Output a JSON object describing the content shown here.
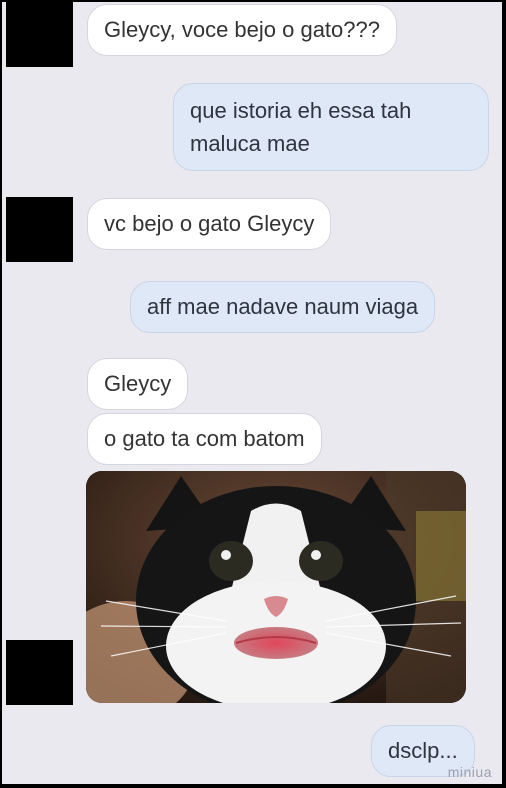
{
  "conversation": {
    "messages": [
      {
        "side": "received",
        "text": "Gleycy, voce bejo o gato???"
      },
      {
        "side": "sent",
        "text": "que istoria eh essa tah maluca mae"
      },
      {
        "side": "received",
        "text": "vc bejo o gato Gleycy"
      },
      {
        "side": "sent",
        "text": "aff mae nadave naum viaga"
      },
      {
        "side": "received",
        "text": "Gleycy"
      },
      {
        "side": "received",
        "text": "o gato ta com batom"
      },
      {
        "side": "sent",
        "text": "dsclp..."
      }
    ],
    "photo": {
      "icon": "cat-with-lipstick-photo"
    }
  },
  "watermark": "miniua",
  "colors": {
    "received_bubble": "#ffffff",
    "sent_bubble": "#dfe8f6",
    "background": "#e9e9ef"
  }
}
